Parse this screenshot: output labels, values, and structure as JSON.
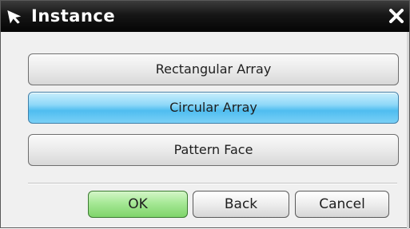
{
  "window": {
    "title": "Instance",
    "icons": {
      "app": "cursor-arrow-icon",
      "close": "close-icon"
    }
  },
  "options": [
    {
      "label": "Rectangular Array",
      "selected": false
    },
    {
      "label": "Circular Array",
      "selected": true
    },
    {
      "label": "Pattern Face",
      "selected": false
    }
  ],
  "actions": {
    "ok_label": "OK",
    "back_label": "Back",
    "cancel_label": "Cancel"
  },
  "colors": {
    "selected_option": "#5cc4f2",
    "ok_button": "#a6e896",
    "titlebar": "#111111"
  }
}
